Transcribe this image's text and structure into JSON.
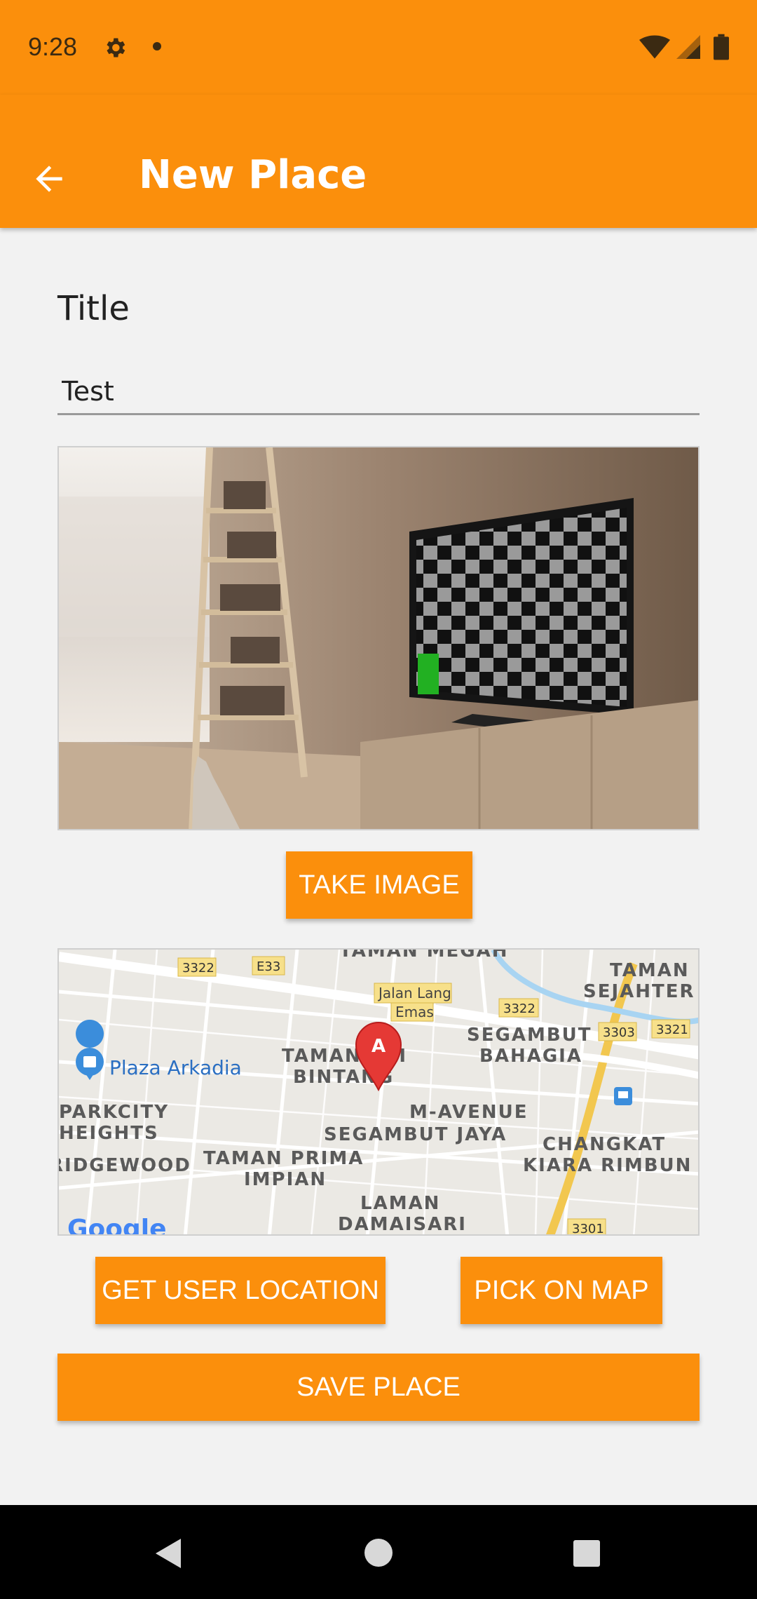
{
  "status_bar": {
    "time": "9:28"
  },
  "app_bar": {
    "title": "New Place"
  },
  "form": {
    "title_label": "Title",
    "title_value": "Test"
  },
  "buttons": {
    "take_image": "TAKE IMAGE",
    "get_user_location": "GET USER LOCATION",
    "pick_on_map": "PICK ON MAP",
    "save_place": "SAVE PLACE"
  },
  "map": {
    "labels": {
      "taman_megah": "TAMAN MEGAH",
      "taman_sejahtera_1": "TAMAN",
      "taman_sejahtera_2": "SEJAHTER",
      "jalan_lang_emas_1": "Jalan Lang",
      "jalan_lang_emas_2": "Emas",
      "segambut_bahagia_1": "SEGAMBUT",
      "segambut_bahagia_2": "BAHAGIA",
      "taman_sri_bintang_1": "TAMAN SRI",
      "taman_sri_bintang_2": "BINTANG",
      "plaza_arkadia": "Plaza Arkadia",
      "parkcity_1": "PARKCITY",
      "parkcity_2": "HEIGHTS",
      "m_avenue": "M-AVENUE",
      "segambut_jaya": "SEGAMBUT JAYA",
      "changkat_1": "CHANGKAT",
      "changkat_2": "KIARA RIMBUN",
      "ridgewood": "RIDGEWOOD",
      "taman_prima_1": "TAMAN PRIMA",
      "taman_prima_2": "IMPIAN",
      "laman_1": "LAMAN",
      "laman_2": "DAMAISARI",
      "google": "Google"
    },
    "road_shields": {
      "r3322a": "3322",
      "e33": "E33",
      "r3322b": "3322",
      "r3303": "3303",
      "r3321": "3321",
      "r3301": "3301"
    },
    "marker_letter": "A",
    "accent": "#e53935"
  },
  "colors": {
    "primary": "#fb8f0c",
    "background": "#f2f2f2"
  }
}
